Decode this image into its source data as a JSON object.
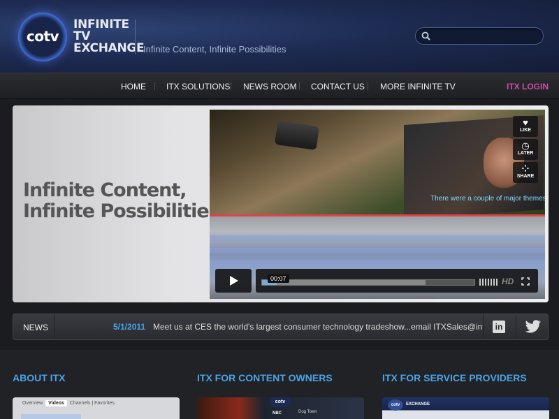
{
  "header": {
    "logo_text": "cotv",
    "brand_lines": [
      "INFINITE",
      "TV",
      "EXCHANGE"
    ],
    "tagline": "Infinite Content, Infinite Possibilities",
    "search_placeholder": ""
  },
  "nav": {
    "items": [
      "HOME",
      "ITX SOLUTIONS",
      "NEWS ROOM",
      "CONTACT US",
      "MORE INFINITE TV"
    ],
    "login": "ITX LOGIN"
  },
  "hero": {
    "title_line1": "Infinite Content,",
    "title_line2": "Infinite Possibilities",
    "video": {
      "subtitle": "There were a couple of major themes which I'll",
      "current_time": "00:07",
      "progress": 0.07,
      "buffered": 0.77,
      "side_buttons": [
        "LIKE",
        "LATER",
        "SHARE"
      ],
      "hd_label": "HD"
    }
  },
  "news": {
    "label": "NEWS",
    "date": "5/1/2011",
    "text": "Meet us at CES the world's largest consumer technology tradeshow...email ITXSales@infinite."
  },
  "sections": {
    "about": {
      "title": "ABOUT ITX",
      "tabs": [
        "Overview",
        "Videos",
        "Channels",
        "Favorites"
      ]
    },
    "content_owners": {
      "title": "ITX FOR CONTENT OWNERS",
      "thumb_logo": "cotv",
      "thumb_channel": "NBC",
      "thumb_show": "Dog Town"
    },
    "service_providers": {
      "title": "ITX FOR SERVICE PROVIDERS",
      "thumb_logo": "cotv",
      "thumb_brand": "EXCHANGE"
    }
  },
  "colors": {
    "accent_blue": "#4aa3e8",
    "login_magenta": "#c84fa8",
    "header_blue": "#1d2b52"
  }
}
